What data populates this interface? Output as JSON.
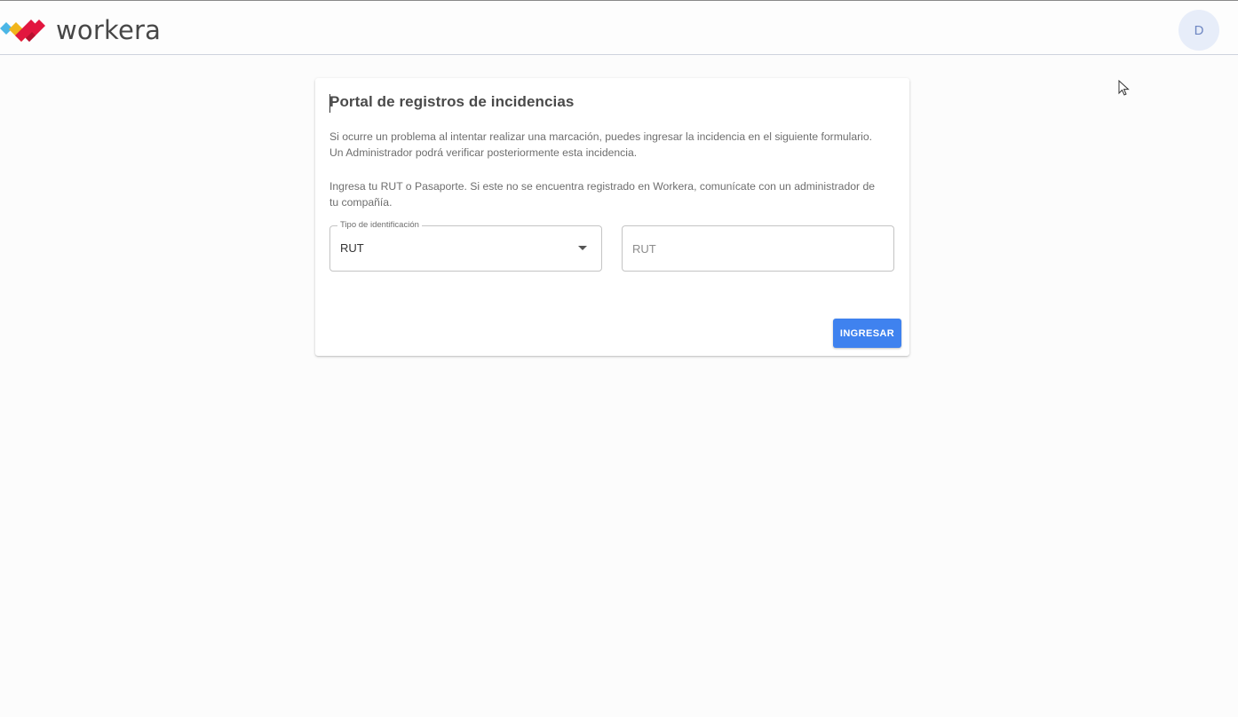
{
  "header": {
    "brand": "workera",
    "avatar_initial": "D",
    "colors": {
      "logo_blue": "#4bb6e6",
      "logo_yellow": "#f1b51c",
      "logo_red": "#e2163f",
      "logo_text": "#474747"
    }
  },
  "card": {
    "title": "Portal de registros de incidencias",
    "paragraph_1": "Si ocurre un problema al intentar realizar una marcación, puedes ingresar la incidencia en el siguiente formulario. Un Administrador podrá verificar posteriormente esta incidencia.",
    "paragraph_2": "Ingresa tu RUT o Pasaporte. Si este no se encuentra registrado en Workera, comunícate con un administrador de tu compañía.",
    "id_type": {
      "label": "Tipo de identificación",
      "value": "RUT",
      "icon": "arrow-drop-down-icon"
    },
    "id_input": {
      "placeholder": "RUT",
      "value": ""
    },
    "submit_label": "INGRESAR",
    "accent_color": "#3f82ef"
  }
}
